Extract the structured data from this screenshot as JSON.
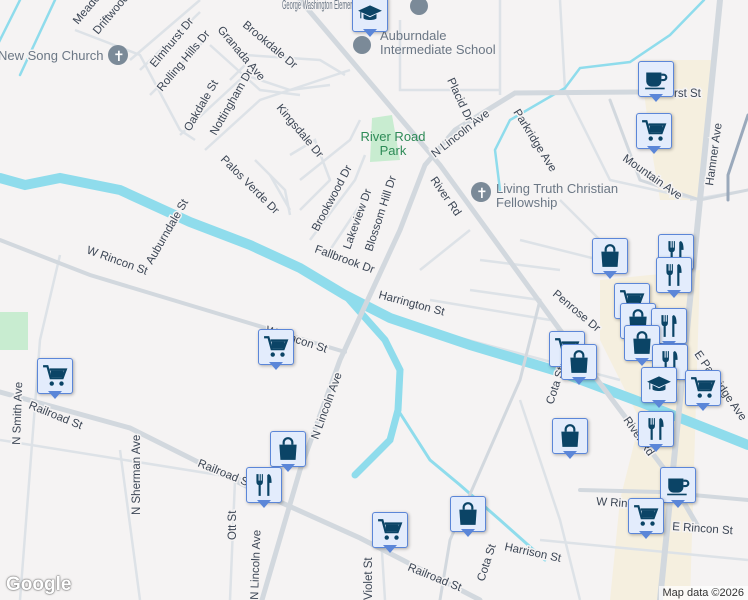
{
  "map": {
    "streets": [
      "Meadow",
      "Driftwood",
      "Elmhurst Dr",
      "Rolling Hills Dr",
      "Granada Ave",
      "Brookdale Dr",
      "Oakdale St",
      "Nottingham Dr",
      "Kingsdale Dr",
      "Palos Verde Dr",
      "Brookwood Dr",
      "Lakeview Dr",
      "Blossom Hill Dr",
      "Fallbrook Dr",
      "Auburndale St",
      "W Rincon St",
      "W Rincon St",
      "N Lincoln Ave",
      "N Lincoln Ave",
      "River Rd",
      "River Rd",
      "Placid Dr",
      "Parkridge Ave",
      "Mountain Ave",
      "Hamner Ave",
      "rst St",
      "Harrington St",
      "Penrose Dr",
      "Cota St",
      "Cota St",
      "E Parkridge Ave",
      "W Rincon St",
      "E Rincon St",
      "Harrison St",
      "Railroad St",
      "Railroad St",
      "Railroad St",
      "N Sherman Ave",
      "N Smith Ave",
      "Ott St",
      "Violet St"
    ],
    "places": {
      "church1": "New Song Church",
      "school1": "George Washington Elementary School",
      "school2": "Auburndale Intermediate School",
      "park": "River Road Park",
      "church2": "Living Truth Christian Fellowship"
    },
    "colors": {
      "water": "#8fdcec",
      "road": "#d5dbe1",
      "park": "#c8ecd0",
      "commercial": "#f5efdf",
      "marker_icon": "#0b4466",
      "marker_bg": "#e3ecfc"
    }
  },
  "footer": {
    "logo": "Google",
    "attribution": "Map data ©2026"
  }
}
